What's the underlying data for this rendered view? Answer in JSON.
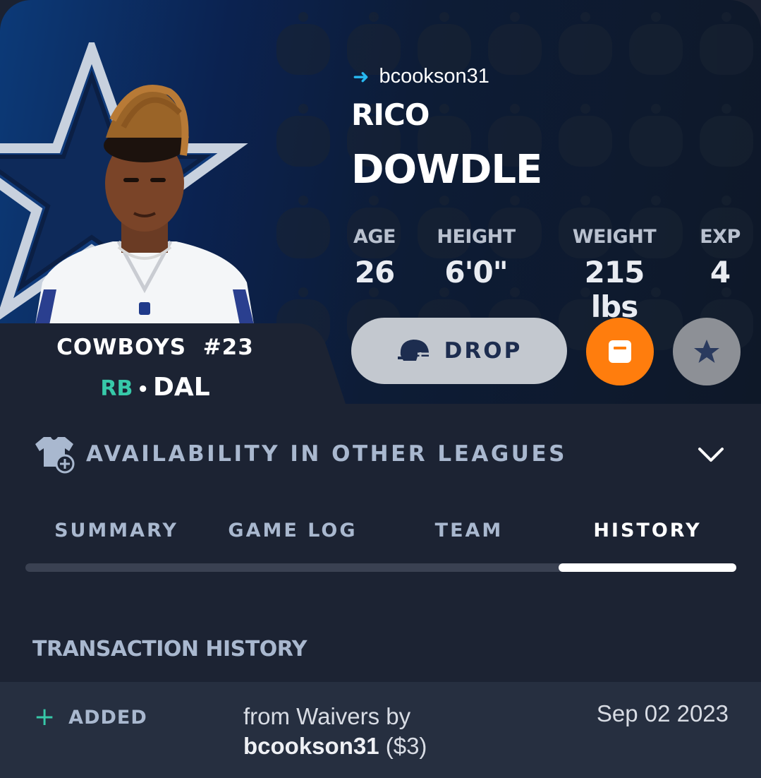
{
  "player": {
    "owner": "bcookson31",
    "first_name": "RICO",
    "last_name": "DOWDLE",
    "team_name": "COWBOYS",
    "number": "#23",
    "position": "RB",
    "team_abbr": "DAL",
    "pos_separator": "•"
  },
  "stats": [
    {
      "label": "AGE",
      "value": "26"
    },
    {
      "label": "HEIGHT",
      "value": "6'0\""
    },
    {
      "label": "WEIGHT",
      "value": "215 lbs"
    },
    {
      "label": "EXP",
      "value": "4"
    }
  ],
  "actions": {
    "drop_label": "DROP",
    "drop_icon": "helmet-icon",
    "orange_icon": "trade-block-icon",
    "grey_icon": "star-icon",
    "accent_orange": "#ff7d0d",
    "accent_teal": "#37c9a9"
  },
  "availability": {
    "label": "AVAILABILITY IN OTHER LEAGUES",
    "icon": "jersey-plus-icon",
    "chevron": "chevron-down-icon"
  },
  "tabs": [
    {
      "label": "SUMMARY",
      "active": false
    },
    {
      "label": "GAME LOG",
      "active": false
    },
    {
      "label": "TEAM",
      "active": false
    },
    {
      "label": "HISTORY",
      "active": true
    }
  ],
  "history": {
    "title": "TRANSACTION HISTORY",
    "transactions": [
      {
        "type_symbol": "+",
        "type": "ADDED",
        "desc_prefix": "from Waivers by",
        "by_user": "bcookson31",
        "amount": "($3)",
        "date": "Sep 02 2023"
      }
    ]
  }
}
